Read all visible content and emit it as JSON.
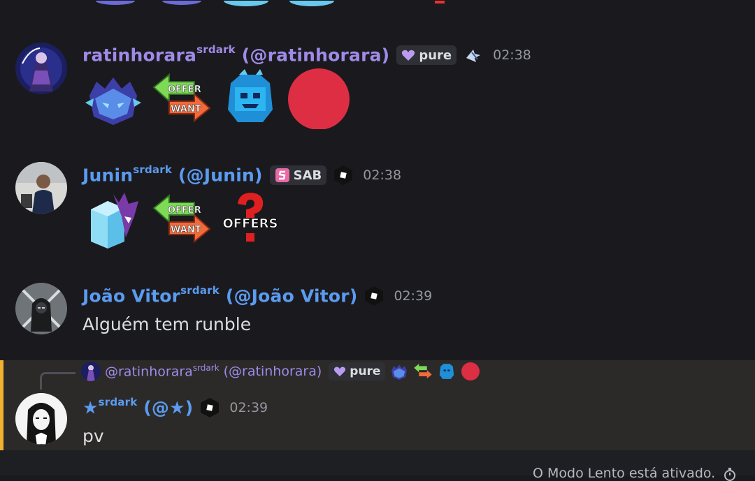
{
  "messages": [
    {
      "display_name": "ratinhorara",
      "suffix": "srdark",
      "handle": "(@ratinhorara)",
      "badge_label": "pure",
      "time": "02:38",
      "emoji_names": [
        "blue-beast-mask-icon",
        "offer-want-arrows-icon",
        "blue-block-fruit-icon",
        "red-circle-icon"
      ]
    },
    {
      "display_name": "Junin",
      "suffix": "srdark",
      "handle": "(@Junin)",
      "badge_label": "SAB",
      "time": "02:38",
      "emoji_names": [
        "ice-block-fruit-icon",
        "offer-want-arrows-icon",
        "question-offers-icon"
      ],
      "offers_label": "OFFERS"
    },
    {
      "display_name": "João Vitor",
      "suffix": "srdark",
      "handle": "(@João Vitor)",
      "time": "02:39",
      "text": "Alguém tem runble"
    },
    {
      "display_name": "★",
      "suffix": "srdark",
      "handle": "(@★)",
      "time": "02:39",
      "text": "pv",
      "reply": {
        "name": "@ratinhorara",
        "suffix": "srdark",
        "handle": "(@ratinhorara)",
        "badge_label": "pure"
      }
    }
  ],
  "emoji_labels": {
    "offer": "OFFER",
    "want": "WANT"
  },
  "footer": {
    "text": "O Modo Lento está ativado."
  },
  "colors": {
    "background": "#1a1a1e",
    "username_blue": "#5b9bf0",
    "username_purple": "#a08ae8",
    "reply_highlight": "#2b2a29",
    "reply_bar": "#f0b232",
    "red_circle": "#dd2e44"
  }
}
